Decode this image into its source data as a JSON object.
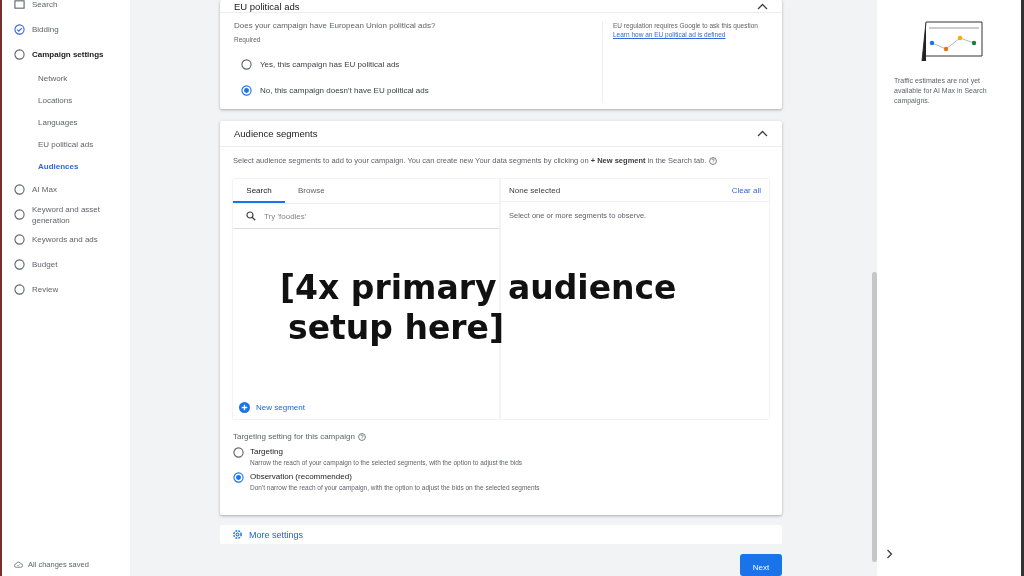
{
  "sidebar": {
    "items": [
      {
        "label": "Search",
        "kind": "type",
        "expanded": false
      },
      {
        "label": "Bidding",
        "kind": "done",
        "expanded": false
      },
      {
        "label": "Campaign settings",
        "kind": "step",
        "expanded": true,
        "children": [
          {
            "label": "Network",
            "selected": false
          },
          {
            "label": "Locations",
            "selected": false
          },
          {
            "label": "Languages",
            "selected": false
          },
          {
            "label": "EU political ads",
            "selected": false
          },
          {
            "label": "Audiences",
            "selected": true
          }
        ]
      },
      {
        "label": "AI Max",
        "kind": "step",
        "expanded": false
      },
      {
        "label": "Keyword and asset generation",
        "kind": "step",
        "expanded": false
      },
      {
        "label": "Keywords and ads",
        "kind": "step",
        "expanded": false
      },
      {
        "label": "Budget",
        "kind": "step",
        "expanded": false
      },
      {
        "label": "Review",
        "kind": "step",
        "expanded": false
      }
    ],
    "save_status": "All changes saved"
  },
  "eu_card": {
    "title": "EU political ads",
    "expanded": true,
    "question": "Does your campaign have European Union political ads?",
    "required": "Required",
    "options": [
      {
        "label": "Yes, this campaign has EU political ads",
        "selected": false
      },
      {
        "label": "No, this campaign doesn't have EU political ads",
        "selected": true
      }
    ],
    "note": "EU regulation requires Google to ask this question",
    "link": "Learn how an EU political ad is defined"
  },
  "audience_card": {
    "title": "Audience segments",
    "expanded": true,
    "description": "Select audience segments to add to your campaign. You can create new Your data segments by clicking on **+ New segment** in the Search tab.",
    "tabs": [
      {
        "label": "Search",
        "selected": true
      },
      {
        "label": "Browse",
        "selected": false
      }
    ],
    "search": {
      "placeholder": "Try 'foodies'"
    },
    "new_segment": "New segment",
    "selected_header": "None selected",
    "clear_all": "Clear all",
    "empty_hint": "Select one or more segments to observe.",
    "targeting_label": "Targeting setting for this campaign",
    "targeting_options": [
      {
        "label": "Targeting",
        "description": "Narrow the reach of your campaign to the selected segments, with the option to adjust the bids",
        "selected": false
      },
      {
        "label": "Observation (recommended)",
        "description": "Don't narrow the reach of your campaign, with the option to adjust the bids on the selected segments",
        "selected": true
      }
    ]
  },
  "overlay_caption": [
    "[4x primary audience",
    "setup here]"
  ],
  "more_settings": "More settings",
  "next_button": "Next",
  "right_panel": {
    "message": "Traffic estimates are not yet available for AI Max in Search campaigns."
  }
}
